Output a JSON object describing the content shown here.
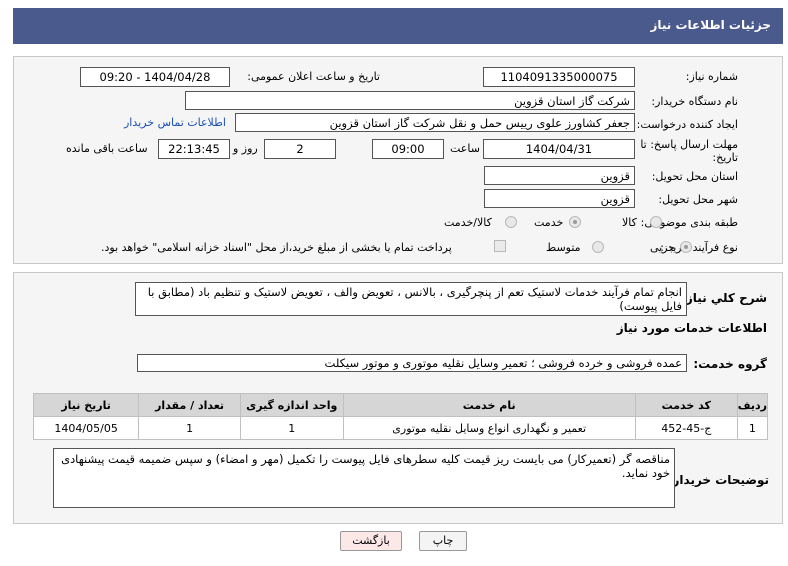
{
  "header": {
    "title": "جزئیات اطلاعات نیاز"
  },
  "fields": {
    "need_number_label": "شماره نیاز:",
    "need_number": "1104091335000075",
    "announce_label": "تاریخ و ساعت اعلان عمومی:",
    "announce_value": "1404/04/28 - 09:20",
    "buyer_org_label": "نام دستگاه خریدار:",
    "buyer_org": "شرکت گاز استان قزوین",
    "requester_label": "ایجاد کننده درخواست:",
    "requester": "جعفر کشاورز علوی رییس حمل و نقل شرکت گاز استان قزوین",
    "contact_link": "اطلاعات تماس خریدار",
    "deadline_label_1": "مهلت ارسال پاسخ: تا",
    "deadline_label_2": "تاریخ:",
    "deadline_date": "1404/04/31",
    "time_label": "ساعت",
    "deadline_time": "09:00",
    "days_value": "2",
    "days_label": "روز و",
    "remaining_time": "22:13:45",
    "remaining_label": "ساعت باقی مانده",
    "province_label": "استان محل تحویل:",
    "province": "قزوین",
    "city_label": "شهر محل تحویل:",
    "city": "قزوین",
    "category_label": "طبقه بندی موضوعی:",
    "category_options": [
      "کالا",
      "خدمت",
      "کالا/خدمت"
    ],
    "purchase_type_label": "نوع فرآیند خرید :",
    "purchase_options": [
      "جزیی",
      "متوسط"
    ],
    "payment_note": "پرداخت تمام یا بخشی از مبلغ خرید،از محل \"اسناد خزانه اسلامی\" خواهد بود."
  },
  "summary": {
    "label": "شرح کلي نياز:",
    "text": "انجام تمام فرآیند خدمات لاستیک تعم از پنچرگیری ، بالانس ، تعویض والف ، تعویض لاستیک و تنظیم باد (مطابق با فایل پیوست)"
  },
  "services": {
    "section_title": "اطلاعات خدمات مورد نیاز",
    "group_label": "گروه خدمت:",
    "group_value": "عمده فروشی و خرده فروشی ؛ تعمیر وسایل نقلیه موتوری و موتور سیکلت",
    "table_headers": [
      "ردیف",
      "کد خدمت",
      "نام خدمت",
      "واحد اندازه گیری",
      "تعداد / مقدار",
      "تاریخ نیاز"
    ],
    "rows": [
      [
        "1",
        "ج-45-452",
        "تعمیر و نگهداری انواع وسایل نقلیه موتوری",
        "1",
        "1",
        "1404/05/05"
      ]
    ]
  },
  "buyer_notes": {
    "label": "توضیحات خریدار:",
    "text": "مناقصه گر (تعمیرکار) می بایست ریز قیمت کلیه سطرهای فایل پیوست را تکمیل (مهر و امضاء) و سپس ضمیمه قیمت پیشنهادی خود نماید."
  },
  "buttons": {
    "print": "چاپ",
    "back": "بازگشت"
  },
  "colors": {
    "title_bar": "#4a5a8c",
    "back_button": "#fde8e8",
    "link": "#1a4fb3"
  }
}
